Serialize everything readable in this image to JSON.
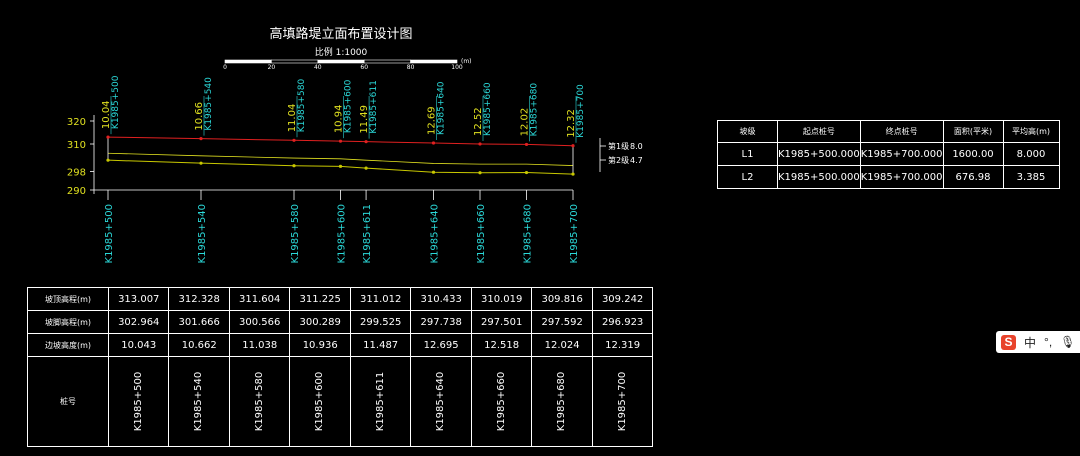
{
  "drawing": {
    "title": "高填路堤立面布置设计图",
    "scale_label": "比例 1:1000",
    "scale_ticks": [
      "0",
      "20",
      "40",
      "60",
      "80",
      "100"
    ],
    "scale_unit": "(m)",
    "y_axis_labels": [
      "320",
      "310",
      "298",
      "290"
    ],
    "level_notes": [
      {
        "label": "第1级",
        "value": "8.0"
      },
      {
        "label": "第2级",
        "value": "4.7"
      }
    ],
    "colors": {
      "top_line": "#e02020",
      "mid_line": "#e0e020",
      "bottom_line": "#c8c800",
      "stake_text": "#2bd9d9",
      "height_text": "#e0e020",
      "frame": "#ffffff"
    }
  },
  "chart_data": {
    "type": "line",
    "stations": [
      "K1985+500",
      "K1985+540",
      "K1985+580",
      "K1985+600",
      "K1985+611",
      "K1985+640",
      "K1985+660",
      "K1985+680",
      "K1985+700"
    ],
    "distance_m": [
      500,
      540,
      580,
      600,
      611,
      640,
      660,
      680,
      700
    ],
    "series": [
      {
        "name": "坡顶高程(m)",
        "values": [
          313.007,
          312.328,
          311.604,
          311.225,
          311.012,
          310.433,
          310.019,
          309.816,
          309.242
        ]
      },
      {
        "name": "坡脚高程(m)",
        "values": [
          302.964,
          301.666,
          300.566,
          300.289,
          299.525,
          297.738,
          297.501,
          297.592,
          296.923
        ]
      }
    ],
    "fill_heights": [
      "10.04",
      "10.66",
      "11.04",
      "10.94",
      "11.49",
      "12.69",
      "12.52",
      "12.02",
      "12.32"
    ],
    "ylim": [
      290,
      320
    ]
  },
  "level_table": {
    "headers": [
      "坡级",
      "起点桩号",
      "终点桩号",
      "面积(平米)",
      "平均高(m)"
    ],
    "rows": [
      [
        "L1",
        "K1985+500.000",
        "K1985+700.000",
        "1600.00",
        "8.000"
      ],
      [
        "L2",
        "K1985+500.000",
        "K1985+700.000",
        "676.98",
        "3.385"
      ]
    ]
  },
  "profile_table": {
    "row_labels": [
      "坡顶高程(m)",
      "坡脚高程(m)",
      "边坡高度(m)",
      "桩号"
    ],
    "top_elev": [
      "313.007",
      "312.328",
      "311.604",
      "311.225",
      "311.012",
      "310.433",
      "310.019",
      "309.816",
      "309.242"
    ],
    "toe_elev": [
      "302.964",
      "301.666",
      "300.566",
      "300.289",
      "299.525",
      "297.738",
      "297.501",
      "297.592",
      "296.923"
    ],
    "slope_height": [
      "10.043",
      "10.662",
      "11.038",
      "10.936",
      "11.487",
      "12.695",
      "12.518",
      "12.024",
      "12.319"
    ],
    "stations": [
      "K1985+500",
      "K1985+540",
      "K1985+580",
      "K1985+600",
      "K1985+611",
      "K1985+640",
      "K1985+660",
      "K1985+680",
      "K1985+700"
    ]
  },
  "ime_toolbar": {
    "logo": "S",
    "mode": "中",
    "punct": "°,",
    "mic": "🎙"
  }
}
